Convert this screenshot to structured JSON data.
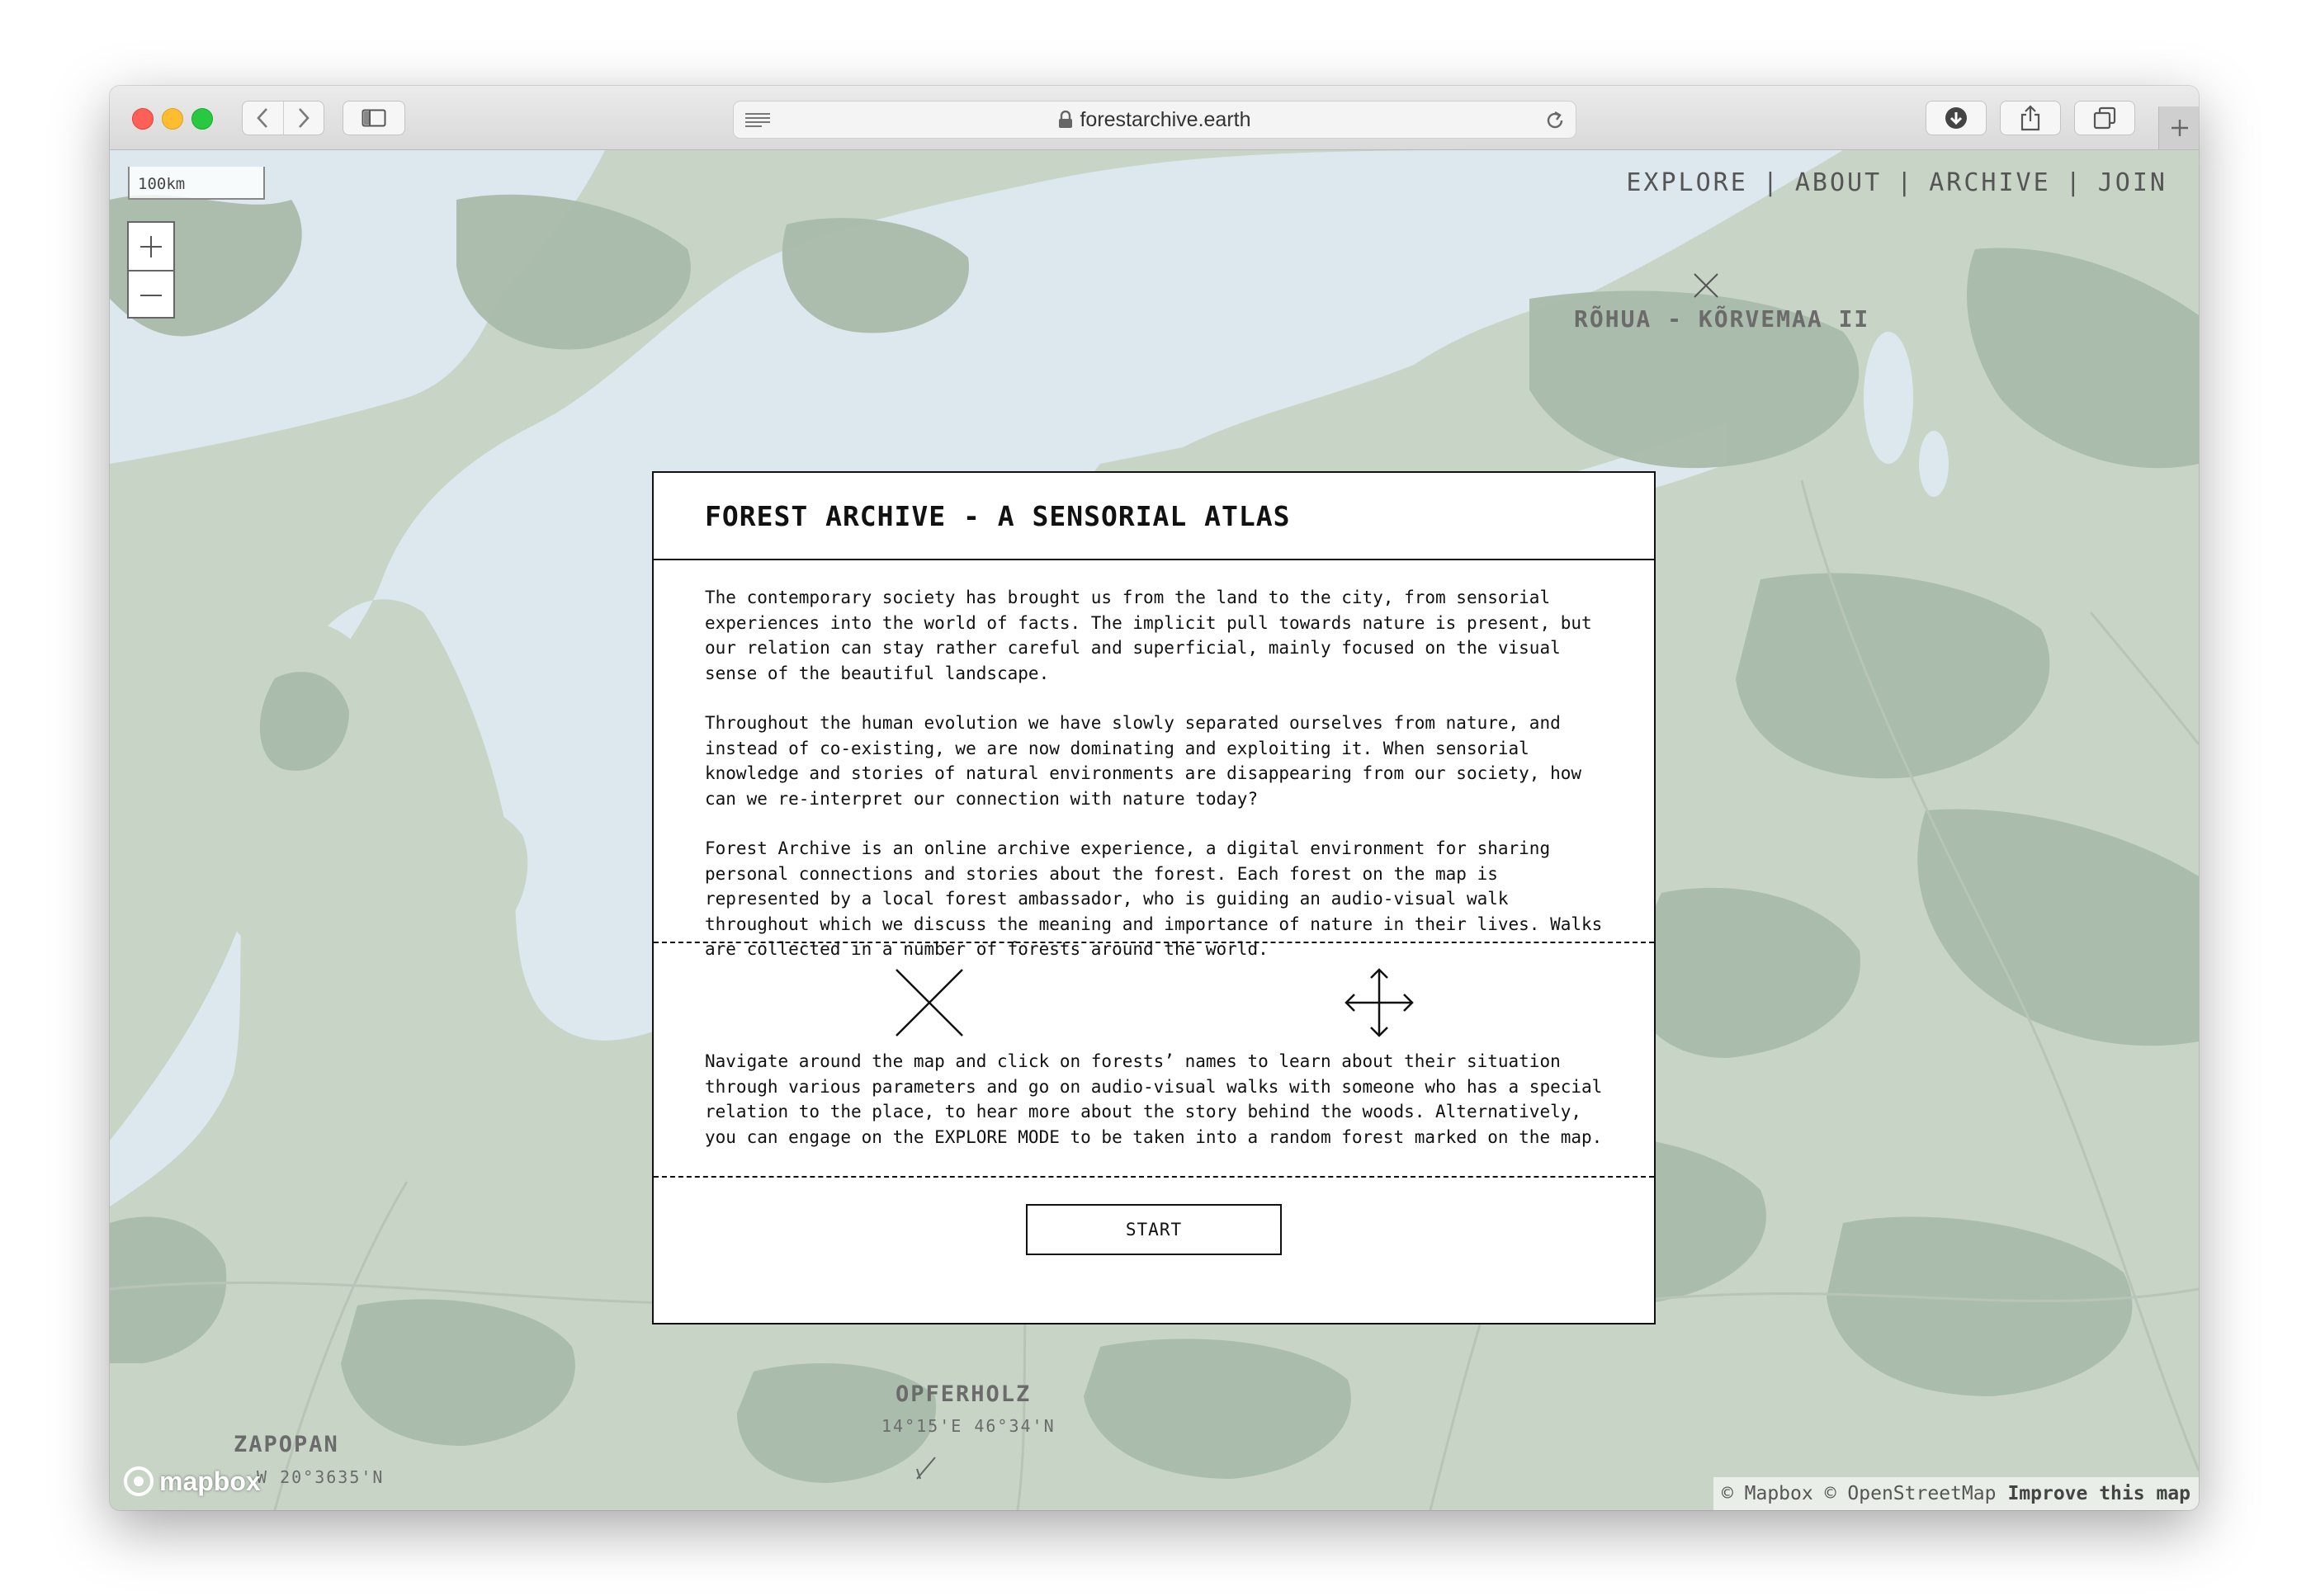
{
  "browser": {
    "url": "forestarchive.earth"
  },
  "map": {
    "scale_label": "100km",
    "zoom_in": "+",
    "zoom_out": "—",
    "nav": [
      "EXPLORE",
      "ABOUT",
      "ARCHIVE",
      "JOIN"
    ],
    "nav_separator": "|",
    "labels": {
      "ruhua": "RÕHUA - KÕRVEMAA II",
      "opferholz": "OPFERHOLZ",
      "opferholz_coord": "14°15'E 46°34'N",
      "zapopan": "ZAPOPAN",
      "zapopan_coord": "W 20°3635'N"
    },
    "logo": "mapbox",
    "attribution": {
      "mapbox": "© Mapbox",
      "osm": "© OpenStreetMap",
      "improve": "Improve this map"
    },
    "colors": {
      "land": "#c7d4c6",
      "forest": "#a9bbaa",
      "water": "#dde8ee"
    }
  },
  "modal": {
    "title": "FOREST ARCHIVE - A SENSORIAL ATLAS",
    "paragraphs": [
      "The contemporary society has brought us from the land to the city, from sensorial experiences into the world of facts. The implicit pull towards nature is present, but our relation can stay rather careful and superficial, mainly focused on the visual sense of the beautiful landscape.",
      "Throughout the human evolution we have slowly separated ourselves from nature, and instead of co-existing, we are now dominating and exploiting it. When sensorial knowledge and stories of natural environments are disappearing from our society, how can we re-interpret our connection with nature today?",
      "Forest Archive is an online archive experience, a digital environment for sharing personal connections and stories about the forest. Each forest on the map is represented by a local forest ambassador, who is guiding an audio-visual walk throughout which we discuss the meaning and importance of nature in their lives. Walks are collected in a number of forests around the world."
    ],
    "icons": [
      "forest-marker-x-icon",
      "move-arrows-icon"
    ],
    "navigate_text": "Navigate around the map and click on forests’ names to learn about their situation through various parameters and go on audio-visual walks with someone who has a special relation to the place, to hear more about the story behind the woods. Alternatively, you can engage on the EXPLORE MODE to be taken into a random forest marked on the map.",
    "start_label": "START"
  }
}
